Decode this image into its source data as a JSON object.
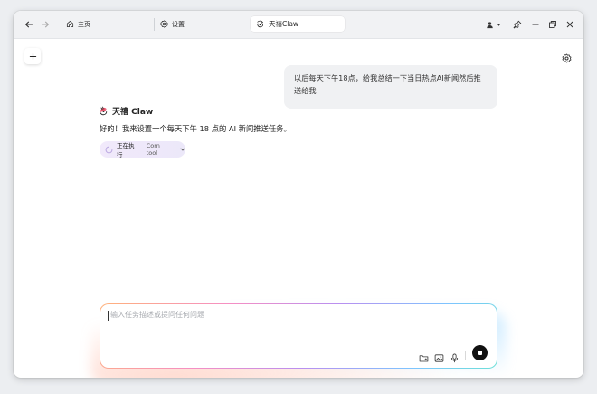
{
  "nav": {
    "home_label": "主页",
    "settings_label": "设置",
    "active_tab_title": "天禧Claw"
  },
  "chat": {
    "user_message": "以后每天下午18点，给我总结一下当日热点AI新闻然后推送给我",
    "bot_name": "天禧 Claw",
    "bot_message": "好的！我来设置一个每天下午 18 点的 AI 新闻推送任务。",
    "exec_status": "正在执行",
    "exec_tool": "Corn tool"
  },
  "input": {
    "placeholder": "输入任务描述或提问任何问题"
  },
  "colors": {
    "accent_gradient": [
      "#ffb27a",
      "#f58fc4",
      "#b98ff0",
      "#7ec4ff",
      "#6ee0d8"
    ],
    "exec_pill_bg": "#f1e9fb"
  },
  "icons": [
    "back-arrow-icon",
    "forward-arrow-icon",
    "home-icon",
    "gear-icon",
    "claw-logo-icon",
    "user-icon",
    "pin-icon",
    "minimize-icon",
    "maximize-icon",
    "close-icon",
    "plus-icon",
    "folder-icon",
    "image-icon",
    "mic-icon",
    "stop-icon",
    "spinner-icon",
    "chevron-down-icon"
  ]
}
